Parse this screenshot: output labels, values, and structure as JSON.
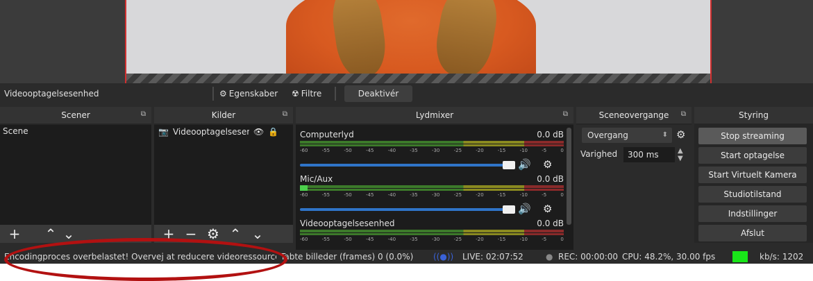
{
  "context_bar": {
    "source_name": "Videooptagelsesenhed",
    "properties": "Egenskaber",
    "filters": "Filtre",
    "deactivate": "Deaktivér"
  },
  "docks": {
    "scenes": {
      "title": "Scener",
      "items": [
        "Scene"
      ]
    },
    "sources": {
      "title": "Kilder",
      "items": [
        "Videooptagelsesenhed"
      ]
    },
    "mixer": {
      "title": "Lydmixer",
      "ticks": [
        "-60",
        "-55",
        "-50",
        "-45",
        "-40",
        "-35",
        "-30",
        "-25",
        "-20",
        "-15",
        "-10",
        "-5",
        "0"
      ],
      "channels": [
        {
          "name": "Computerlyd",
          "db": "0.0 dB",
          "level": 0
        },
        {
          "name": "Mic/Aux",
          "db": "0.0 dB",
          "level": 0.03
        },
        {
          "name": "Videooptagelsesenhed",
          "db": "0.0 dB",
          "level": 0
        }
      ]
    },
    "transitions": {
      "title": "Sceneovergange",
      "selected": "Overgang",
      "duration_label": "Varighed",
      "duration_value": "300 ms"
    },
    "controls": {
      "title": "Styring",
      "buttons": [
        "Stop streaming",
        "Start optagelse",
        "Start Virtuelt Kamera",
        "Studiotilstand",
        "Indstillinger",
        "Afslut"
      ]
    }
  },
  "status": {
    "warning": "Encodingproces overbelastet! Overvej at reducere videoressource",
    "dropped": "Tabte billeder (frames) 0 (0.0%)",
    "live": "LIVE: 02:07:52",
    "rec": "REC: 00:00:00",
    "cpu": "CPU: 48.2%, 30.00 fps",
    "kbps": "kb/s: 1202"
  },
  "colors": {
    "accent": "#2f74c8",
    "live_indicator": "#19e619",
    "annotation": "#b21111"
  }
}
